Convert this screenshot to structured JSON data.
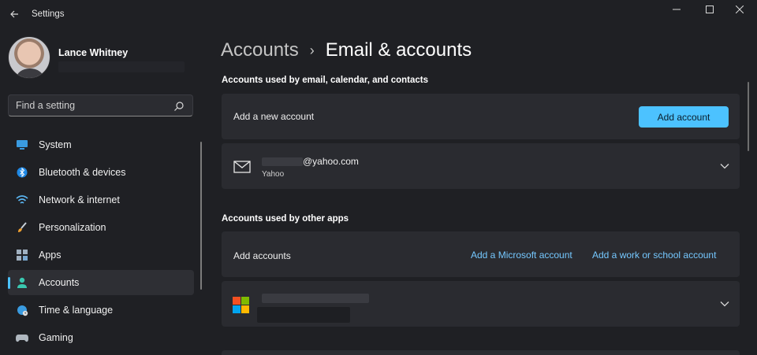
{
  "window": {
    "title": "Settings"
  },
  "profile": {
    "name": "Lance Whitney"
  },
  "search": {
    "placeholder": "Find a setting"
  },
  "sidebar": {
    "items": [
      {
        "label": "System",
        "icon": "monitor-icon",
        "active": false
      },
      {
        "label": "Bluetooth & devices",
        "icon": "bluetooth-icon",
        "active": false
      },
      {
        "label": "Network & internet",
        "icon": "wifi-icon",
        "active": false
      },
      {
        "label": "Personalization",
        "icon": "brush-icon",
        "active": false
      },
      {
        "label": "Apps",
        "icon": "apps-icon",
        "active": false
      },
      {
        "label": "Accounts",
        "icon": "person-icon",
        "active": true
      },
      {
        "label": "Time & language",
        "icon": "globe-clock-icon",
        "active": false
      },
      {
        "label": "Gaming",
        "icon": "gamepad-icon",
        "active": false
      }
    ]
  },
  "breadcrumb": {
    "parent": "Accounts",
    "separator": "›",
    "current": "Email & accounts"
  },
  "email_section": {
    "title": "Accounts used by email, calendar, and contacts",
    "add_row_label": "Add a new account",
    "add_button": "Add account",
    "account": {
      "email_suffix": "@yahoo.com",
      "provider": "Yahoo"
    }
  },
  "other_section": {
    "title": "Accounts used by other apps",
    "add_row_label": "Add accounts",
    "add_microsoft_link": "Add a Microsoft account",
    "add_work_link": "Add a work or school account"
  },
  "colors": {
    "accent": "#4cc2ff",
    "link": "#75c8ff",
    "background": "#1f2024",
    "card": "#2a2b30"
  }
}
